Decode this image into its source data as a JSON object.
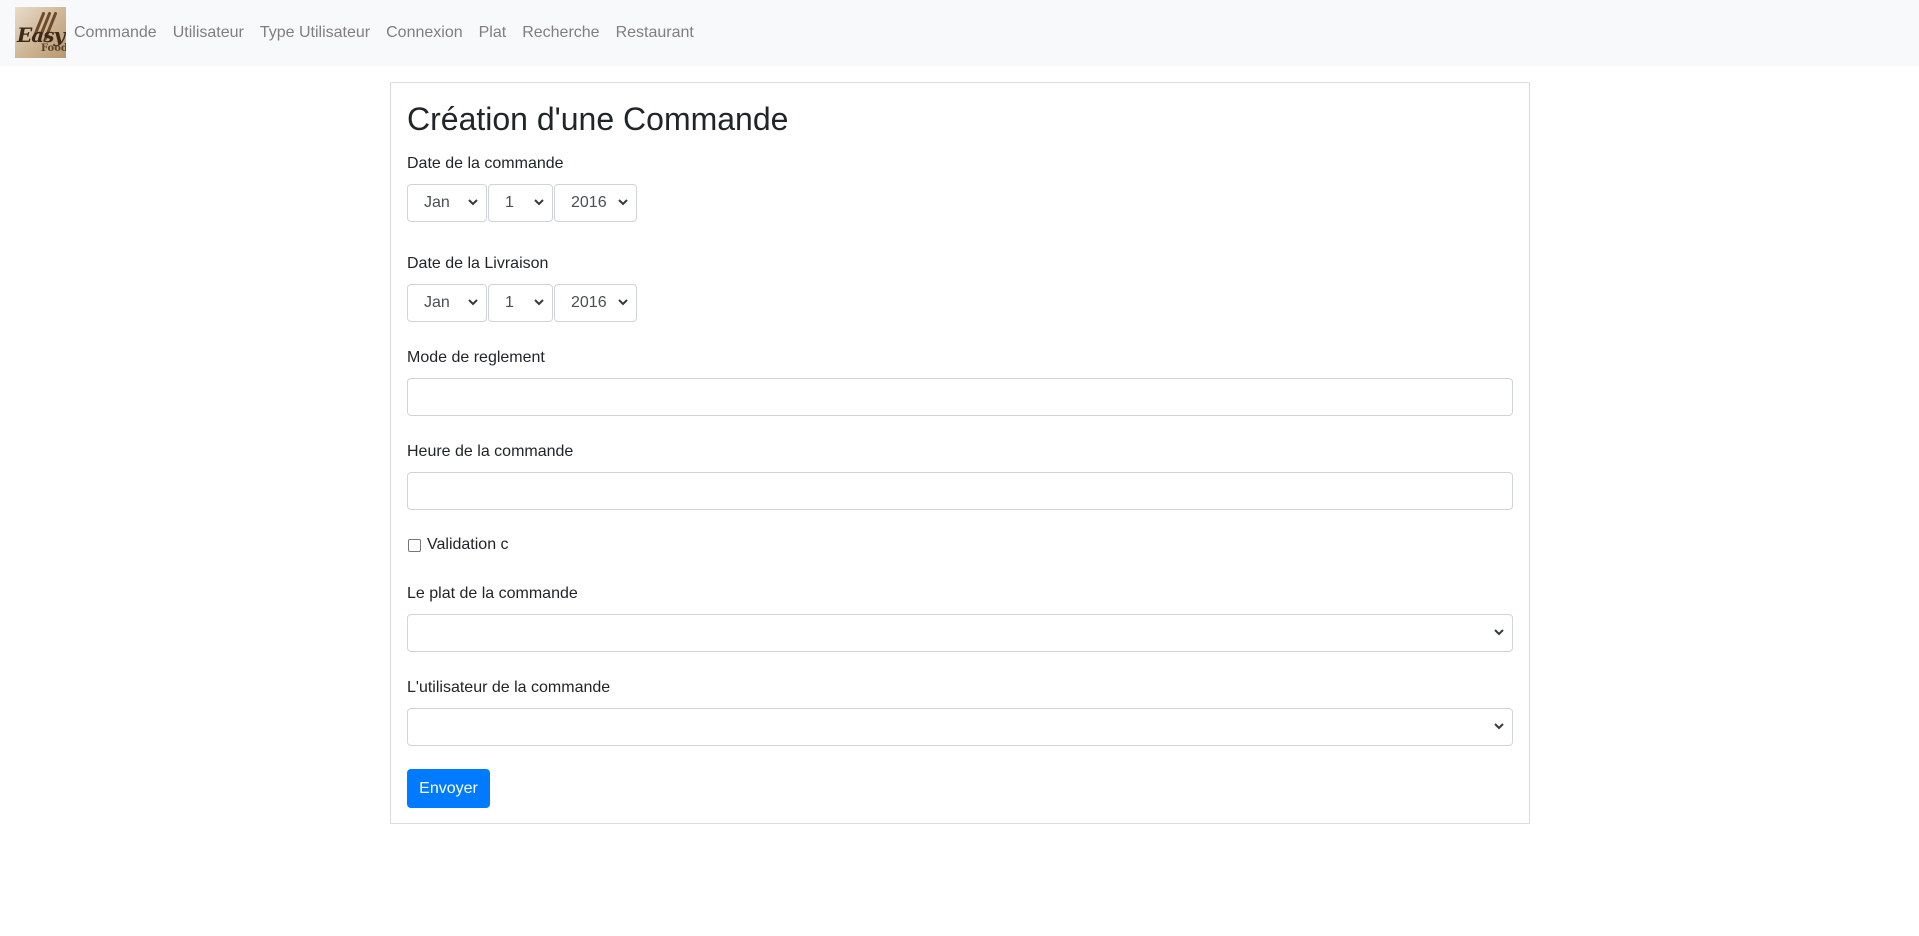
{
  "nav": {
    "logo": {
      "word1": "Easy",
      "word2": "Food"
    },
    "links": [
      "Commande",
      "Utilisateur",
      "Type Utilisateur",
      "Connexion",
      "Plat",
      "Recherche",
      "Restaurant"
    ]
  },
  "form": {
    "title": "Création d'une Commande",
    "date_commande": {
      "label": "Date de la commande",
      "month": "Jan",
      "day": "1",
      "year": "2016"
    },
    "date_livraison": {
      "label": "Date de la Livraison",
      "month": "Jan",
      "day": "1",
      "year": "2016"
    },
    "mode_reglement": {
      "label": "Mode de reglement",
      "value": ""
    },
    "heure_commande": {
      "label": "Heure de la commande",
      "value": ""
    },
    "validation": {
      "label": "Validation c",
      "checked": false
    },
    "plat": {
      "label": "Le plat de la commande",
      "value": ""
    },
    "utilisateur": {
      "label": "L'utilisateur de la commande",
      "value": ""
    },
    "submit_label": "Envoyer"
  },
  "colors": {
    "accent": "#007bff",
    "navbar_bg": "#f8f9fa",
    "nav_text": "#7f7f7f",
    "border": "#ced4da"
  },
  "icons": {
    "select_arrow": "chevron-down-icon"
  }
}
